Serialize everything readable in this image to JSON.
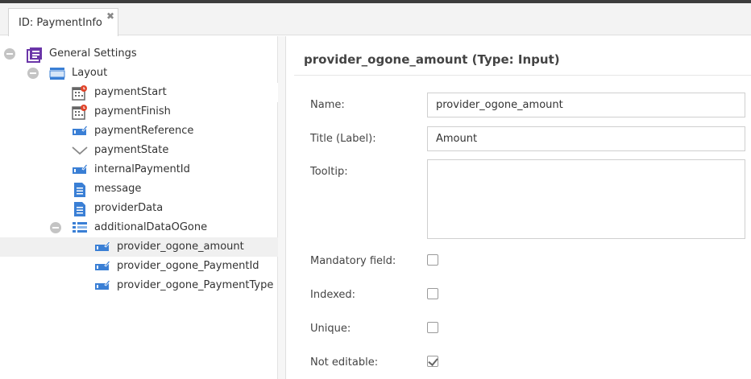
{
  "tab": {
    "label": "ID: PaymentInfo",
    "close": "✖"
  },
  "tree": {
    "root": "General Settings",
    "layout": "Layout",
    "items": [
      {
        "label": "paymentStart",
        "icon": "date-icon"
      },
      {
        "label": "paymentFinish",
        "icon": "date-icon"
      },
      {
        "label": "paymentReference",
        "icon": "input-icon"
      },
      {
        "label": "paymentState",
        "icon": "select-icon"
      },
      {
        "label": "internalPaymentId",
        "icon": "input-icon"
      },
      {
        "label": "message",
        "icon": "textarea-icon"
      },
      {
        "label": "providerData",
        "icon": "textarea-icon"
      }
    ],
    "group": "additionalDataOGone",
    "subitems": [
      {
        "label": "provider_ogone_amount",
        "icon": "input-icon"
      },
      {
        "label": "provider_ogone_PaymentId",
        "icon": "input-icon"
      },
      {
        "label": "provider_ogone_PaymentType",
        "icon": "input-icon"
      }
    ]
  },
  "detail": {
    "title": "provider_ogone_amount (Type: Input)",
    "name_label": "Name:",
    "name_value": "provider_ogone_amount",
    "title_label": "Title (Label):",
    "title_value": "Amount",
    "tooltip_label": "Tooltip:",
    "tooltip_value": "",
    "mandatory_label": "Mandatory field:",
    "mandatory": false,
    "indexed_label": "Indexed:",
    "indexed": false,
    "unique_label": "Unique:",
    "unique": false,
    "noteditable_label": "Not editable:",
    "noteditable": true
  },
  "colors": {
    "accent": "#3a7fd5",
    "root_icon": "#6a35a8",
    "badge": "#e0452b"
  }
}
